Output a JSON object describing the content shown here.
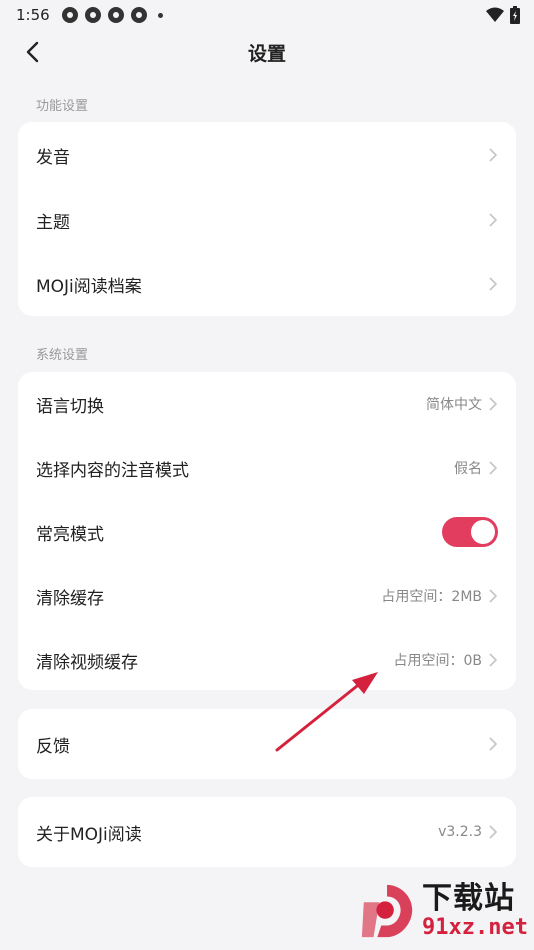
{
  "status_bar": {
    "time": "1:56"
  },
  "header": {
    "title": "设置"
  },
  "sections": {
    "feature_label": "功能设置",
    "system_label": "系统设置"
  },
  "feature_items": [
    {
      "label": "发音"
    },
    {
      "label": "主题"
    },
    {
      "label": "MOJi阅读档案"
    }
  ],
  "system_items": [
    {
      "label": "语言切换",
      "value": "简体中文"
    },
    {
      "label": "选择内容的注音模式",
      "value": "假名"
    },
    {
      "label": "常亮模式",
      "toggle_on": true
    },
    {
      "label": "清除缓存",
      "value": "占用空间：2MB"
    },
    {
      "label": "清除视频缓存",
      "value": "占用空间：0B"
    }
  ],
  "feedback": {
    "label": "反馈"
  },
  "about": {
    "label": "关于MOJi阅读",
    "value": "v3.2.3"
  },
  "watermark": {
    "title": "下载站",
    "url": "91xz.net"
  },
  "colors": {
    "accent": "#e23c5e",
    "background": "#f4f4f6",
    "arrow": "#d4213e"
  }
}
